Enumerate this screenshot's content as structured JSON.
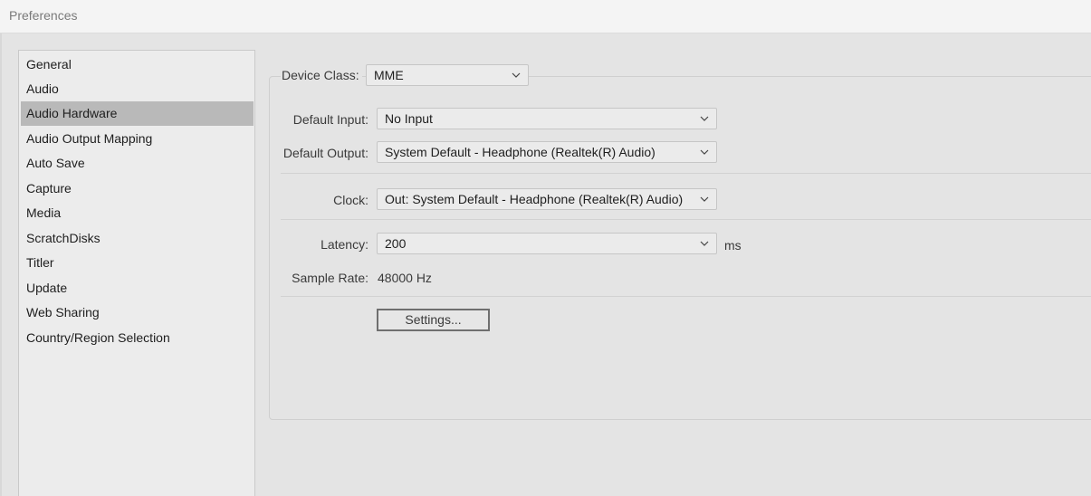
{
  "window": {
    "title": "Preferences"
  },
  "sidebar": {
    "items": [
      {
        "label": "General",
        "selected": false
      },
      {
        "label": "Audio",
        "selected": false
      },
      {
        "label": "Audio Hardware",
        "selected": true
      },
      {
        "label": "Audio Output Mapping",
        "selected": false
      },
      {
        "label": "Auto Save",
        "selected": false
      },
      {
        "label": "Capture",
        "selected": false
      },
      {
        "label": "Media",
        "selected": false
      },
      {
        "label": "ScratchDisks",
        "selected": false
      },
      {
        "label": "Titler",
        "selected": false
      },
      {
        "label": "Update",
        "selected": false
      },
      {
        "label": "Web Sharing",
        "selected": false
      },
      {
        "label": "Country/Region Selection",
        "selected": false
      }
    ]
  },
  "audio_hardware": {
    "device_class": {
      "label": "Device Class:",
      "value": "MME"
    },
    "default_input": {
      "label": "Default Input:",
      "value": "No Input"
    },
    "default_output": {
      "label": "Default Output:",
      "value": "System Default - Headphone (Realtek(R) Audio)"
    },
    "clock": {
      "label": "Clock:",
      "value": "Out: System Default - Headphone (Realtek(R) Audio)"
    },
    "latency": {
      "label": "Latency:",
      "value": "200",
      "unit": "ms"
    },
    "sample_rate": {
      "label": "Sample Rate:",
      "value": "48000 Hz"
    },
    "settings_button": "Settings..."
  },
  "icons": {
    "dropdown_arrow": "chevron-down-icon"
  },
  "colors": {
    "selected_item_bg": "#b9b9b9",
    "window_bg": "#e4e4e4"
  }
}
